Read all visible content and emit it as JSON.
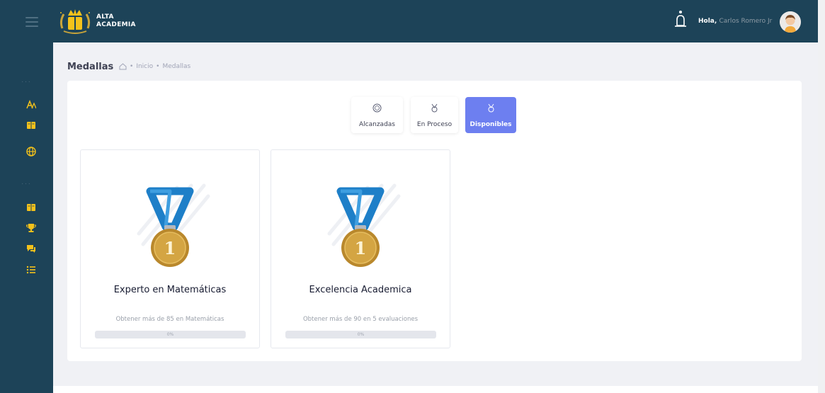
{
  "header": {
    "brand_line1": "ALTA",
    "brand_line2": "ACADEMIA",
    "greeting": "Hola,",
    "user_name": "Carlos Romero Jr"
  },
  "sidebar": {
    "separators": [
      "...",
      "..."
    ],
    "icons": [
      "font-icon",
      "book-icon",
      "globe-icon",
      "book-icon",
      "trophy-icon",
      "chat-icon",
      "list-icon"
    ]
  },
  "page": {
    "title": "Medallas",
    "breadcrumb": [
      "Inicio",
      "Medallas"
    ]
  },
  "tabs": [
    {
      "label": "Alcanzadas",
      "icon": "medal-badge-icon",
      "active": false
    },
    {
      "label": "En Proceso",
      "icon": "medal-outline-icon",
      "active": false
    },
    {
      "label": "Disponibles",
      "icon": "medal-outline-icon",
      "active": true
    }
  ],
  "medals": [
    {
      "title": "Experto en Matemáticas",
      "description": "Obtener más de 85 en Matemáticas",
      "progress_label": "0%",
      "progress": 0
    },
    {
      "title": "Excelencia Academica",
      "description": "Obtener más de 90 en 5 evaluaciones",
      "progress_label": "0%",
      "progress": 0
    }
  ],
  "medal_rank_label": "1",
  "colors": {
    "sidebar": "#1d4358",
    "accent": "#6d7ff0",
    "ribbon": "#1e7fc8",
    "gold": "#c99a3a",
    "icon_yellow": "#f4c21b"
  }
}
